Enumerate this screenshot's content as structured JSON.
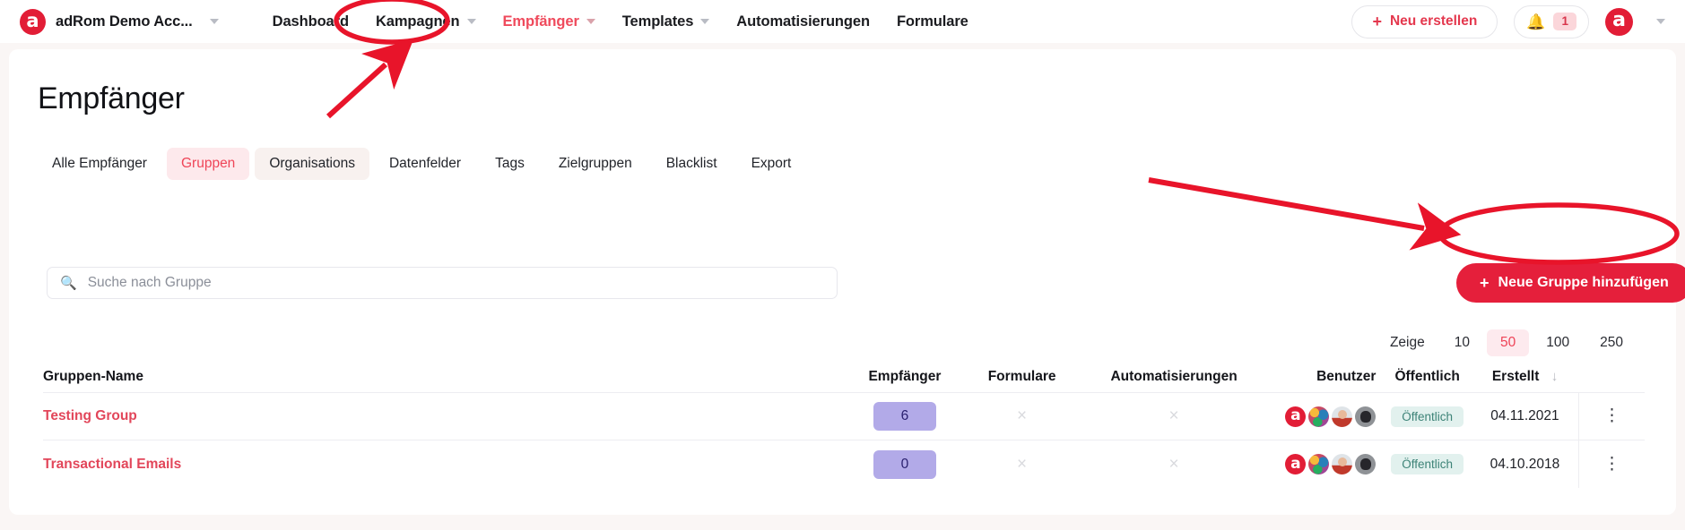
{
  "navbar": {
    "logo_letter": "a",
    "brand_name": "adRom Demo Acc...",
    "links": [
      {
        "label": "Dashboard",
        "has_caret": false,
        "active": false
      },
      {
        "label": "Kampagnen",
        "has_caret": true,
        "active": false
      },
      {
        "label": "Empfänger",
        "has_caret": true,
        "active": true
      },
      {
        "label": "Templates",
        "has_caret": true,
        "active": false
      },
      {
        "label": "Automatisierungen",
        "has_caret": false,
        "active": false
      },
      {
        "label": "Formulare",
        "has_caret": false,
        "active": false
      }
    ],
    "new_button_label": "Neu erstellen",
    "new_button_plus": "+",
    "notification_count": "1",
    "bell_icon": "bell-icon",
    "avatar_letter": "a"
  },
  "page": {
    "title": "Empfänger",
    "tabs": [
      {
        "label": "Alle Empfänger",
        "state": "default"
      },
      {
        "label": "Gruppen",
        "state": "active"
      },
      {
        "label": "Organisations",
        "state": "hovered"
      },
      {
        "label": "Datenfelder",
        "state": "default"
      },
      {
        "label": "Tags",
        "state": "default"
      },
      {
        "label": "Zielgruppen",
        "state": "default"
      },
      {
        "label": "Blacklist",
        "state": "default"
      },
      {
        "label": "Export",
        "state": "default"
      }
    ],
    "search": {
      "placeholder": "Suche nach Gruppe",
      "value": "",
      "icon": "search-icon"
    },
    "add_button": {
      "label": "Neue Gruppe hinzufügen",
      "plus": "+"
    },
    "pager": {
      "label": "Zeige",
      "options": [
        "10",
        "50",
        "100",
        "250"
      ],
      "selected": "50"
    },
    "table": {
      "columns": [
        "Gruppen-Name",
        "Empfänger",
        "Formulare",
        "Automatisierungen",
        "Benutzer",
        "Öffentlich",
        "Erstellt"
      ],
      "sort_column": "Erstellt",
      "sort_arrow": "↓",
      "rows": [
        {
          "name": "Testing Group",
          "empfaenger": "6",
          "formulare": "×",
          "automatisierungen": "×",
          "benutzer": [
            "a",
            "avatar-colorful",
            "avatar-person",
            "avatar-dark"
          ],
          "oeffentlich": "Öffentlich",
          "erstellt": "04.11.2021",
          "menu": "⋮"
        },
        {
          "name": "Transactional Emails",
          "empfaenger": "0",
          "formulare": "×",
          "automatisierungen": "×",
          "benutzer": [
            "a",
            "avatar-colorful",
            "avatar-person",
            "avatar-dark"
          ],
          "oeffentlich": "Öffentlich",
          "erstellt": "04.10.2018",
          "menu": "⋮"
        }
      ]
    }
  },
  "annotations": {
    "color": "#e8142a",
    "items": [
      {
        "name": "ellipse-empfaenger-nav",
        "shape": "ellipse"
      },
      {
        "name": "arrow-to-empfaenger-nav",
        "shape": "arrow"
      },
      {
        "name": "ellipse-neue-gruppe-button",
        "shape": "ellipse"
      },
      {
        "name": "arrow-to-neue-gruppe-button",
        "shape": "arrow"
      }
    ]
  },
  "colors": {
    "brand_red": "#e21d36",
    "accent_red": "#ef4a5c",
    "button_red": "#e51f3b",
    "pill_purple": "#b2aae8",
    "badge_teal": "#e2f1ee",
    "page_bg": "#faf6f5",
    "annotation_red": "#e8142a"
  }
}
